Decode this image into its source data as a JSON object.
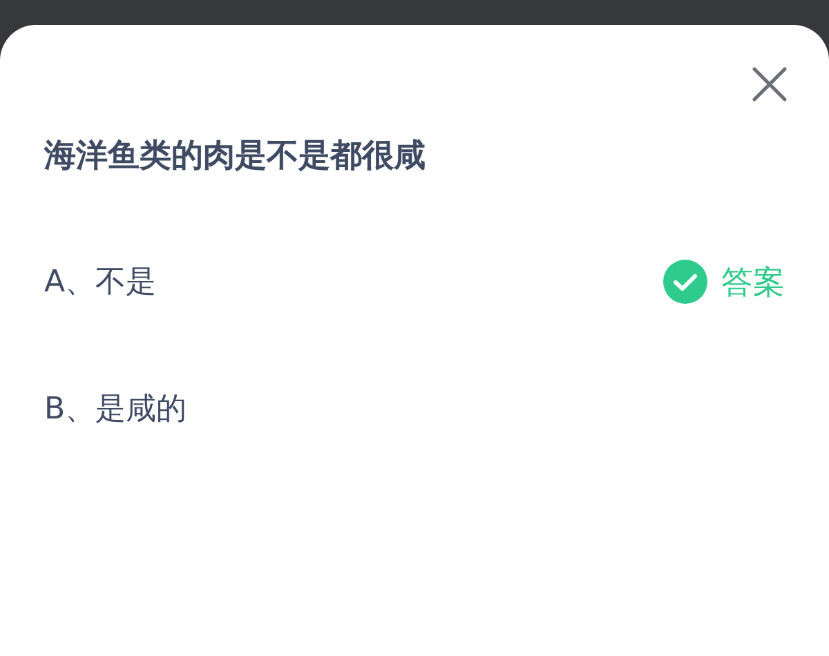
{
  "question": "海洋鱼类的肉是不是都很咸",
  "options": [
    {
      "label": "A、不是",
      "correct": true,
      "answer_label": "答案"
    },
    {
      "label": "B、是咸的",
      "correct": false
    }
  ]
}
